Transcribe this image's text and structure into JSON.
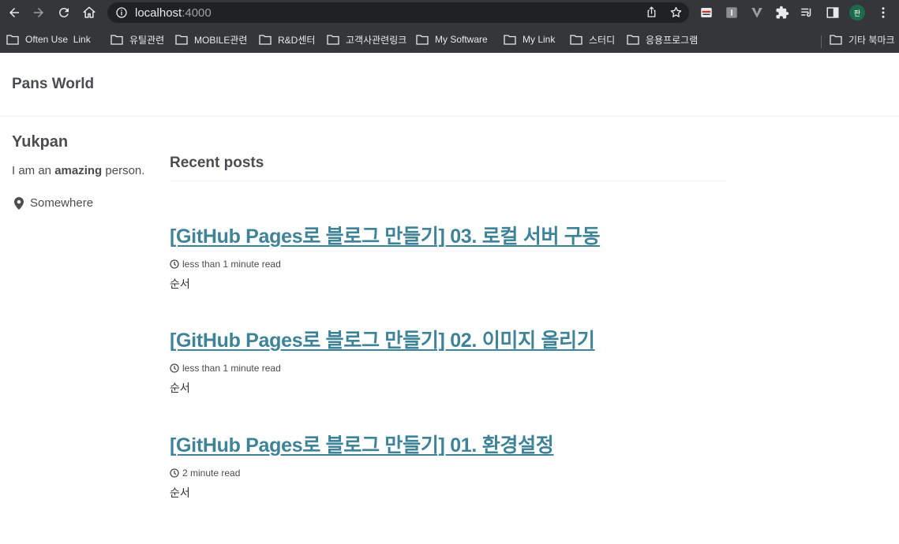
{
  "browser": {
    "url_host": "localhost",
    "url_port": ":4000",
    "profile_initial": "판",
    "bookmarks": [
      {
        "label": "Often Use  Link"
      },
      {
        "label": "유틸관련"
      },
      {
        "label": "MOBILE관련"
      },
      {
        "label": "R&D센터"
      },
      {
        "label": "고객사관련링크"
      },
      {
        "label": "My Software"
      },
      {
        "label": "My Link"
      },
      {
        "label": "스터디"
      },
      {
        "label": "응용프로그램"
      }
    ],
    "other_bookmarks": "기타 북마크"
  },
  "site": {
    "title": "Pans World"
  },
  "author": {
    "name": "Yukpan",
    "bio_prefix": "I am an ",
    "bio_bold": "amazing",
    "bio_suffix": " person.",
    "location": "Somewhere"
  },
  "main": {
    "heading": "Recent posts",
    "posts": [
      {
        "title": "[GitHub Pages로 블로그 만들기] 03. 로컬 서버 구동",
        "read_time": "less than 1 minute read",
        "excerpt": "순서"
      },
      {
        "title": "[GitHub Pages로 블로그 만들기] 02. 이미지 올리기",
        "read_time": "less than 1 minute read",
        "excerpt": "순서"
      },
      {
        "title": "[GitHub Pages로 블로그 만들기] 01. 환경설정",
        "read_time": "2 minute read",
        "excerpt": "순서"
      }
    ]
  },
  "colors": {
    "chrome_bg": "#35363a",
    "omnibox_bg": "#202124",
    "link": "#3e8397",
    "text": "#494e52"
  },
  "icons": [
    "back-arrow-icon",
    "forward-arrow-icon",
    "reload-icon",
    "home-icon",
    "info-icon",
    "share-icon",
    "star-icon",
    "puzzle-icon",
    "reading-list-icon",
    "side-panel-icon",
    "kebab-menu-icon",
    "folder-icon",
    "map-marker-icon",
    "clock-icon"
  ]
}
